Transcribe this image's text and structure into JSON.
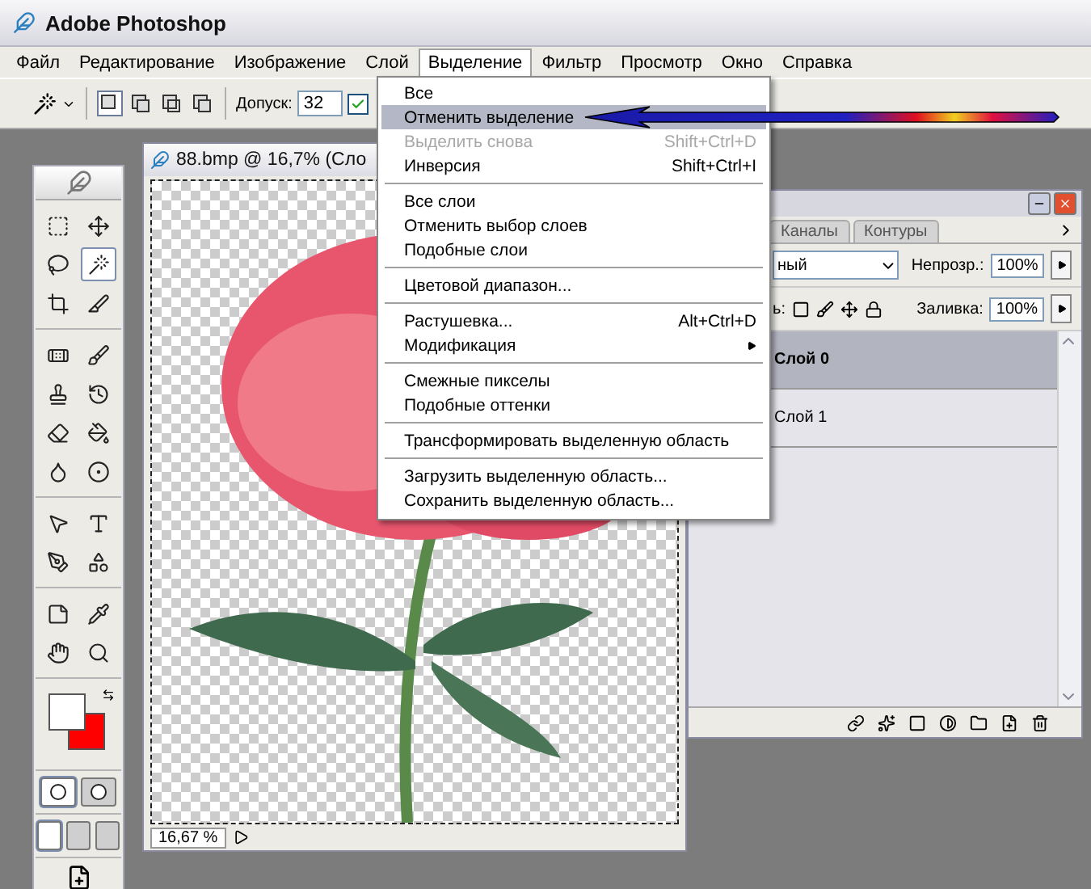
{
  "window": {
    "title": "Adobe Photoshop"
  },
  "menu_bar": [
    {
      "label": "Файл",
      "selected": false
    },
    {
      "label": "Редактирование",
      "selected": false
    },
    {
      "label": "Изображение",
      "selected": false
    },
    {
      "label": "Слой",
      "selected": false
    },
    {
      "label": "Выделение",
      "selected": true
    },
    {
      "label": "Фильтр",
      "selected": false
    },
    {
      "label": "Просмотр",
      "selected": false
    },
    {
      "label": "Окно",
      "selected": false
    },
    {
      "label": "Справка",
      "selected": false
    }
  ],
  "options_bar": {
    "selection_modes": [
      {
        "selected": true
      },
      {
        "selected": false
      },
      {
        "selected": false
      },
      {
        "selected": false
      }
    ],
    "tolerance_label": "Допуск:",
    "tolerance_value": "32",
    "checkbox": {
      "checked": true
    }
  },
  "toolbox": {
    "tool_groups": [
      [
        {
          "kind": "marquee",
          "selected": false
        },
        {
          "kind": "move",
          "selected": false
        },
        {
          "kind": "lasso",
          "selected": false
        },
        {
          "kind": "wand",
          "selected": true
        },
        {
          "kind": "crop",
          "selected": false
        },
        {
          "kind": "slice",
          "selected": false
        }
      ],
      [
        {
          "kind": "healing",
          "selected": false
        },
        {
          "kind": "brush",
          "selected": false
        },
        {
          "kind": "stamp",
          "selected": false
        },
        {
          "kind": "history",
          "selected": false
        },
        {
          "kind": "eraser",
          "selected": false
        },
        {
          "kind": "bucket",
          "selected": false
        },
        {
          "kind": "blur",
          "selected": false
        },
        {
          "kind": "dodge",
          "selected": false
        }
      ],
      [
        {
          "kind": "pointer",
          "selected": false
        },
        {
          "kind": "type",
          "selected": false
        },
        {
          "kind": "pen",
          "selected": false
        },
        {
          "kind": "shape",
          "selected": false
        }
      ],
      [
        {
          "kind": "notes",
          "selected": false
        },
        {
          "kind": "eyedropper",
          "selected": false
        },
        {
          "kind": "hand",
          "selected": false
        },
        {
          "kind": "zoom",
          "selected": false
        }
      ]
    ],
    "swatches": [
      {
        "color": "#ffffff"
      },
      {
        "color": "#ff0000"
      }
    ],
    "mask_modes": [
      {
        "selected": true
      },
      {
        "selected": false
      }
    ],
    "screen_modes": [
      {
        "selected": true
      },
      {
        "selected": false
      },
      {
        "selected": false
      }
    ]
  },
  "document": {
    "title": "88.bmp @ 16,7% (Сло",
    "zoom": "16,67 %"
  },
  "selection_menu": {
    "groups": [
      [
        {
          "label": "Все",
          "disabled": false,
          "selected": false,
          "submenu": false
        },
        {
          "label": "Отменить выделение",
          "disabled": false,
          "selected": true,
          "submenu": false
        },
        {
          "label": "Выделить снова",
          "shortcut": "Shift+Ctrl+D",
          "disabled": true,
          "selected": false,
          "submenu": false
        },
        {
          "label": "Инверсия",
          "shortcut": "Shift+Ctrl+I",
          "disabled": false,
          "selected": false,
          "submenu": false
        }
      ],
      [
        {
          "label": "Все слои",
          "disabled": false,
          "selected": false,
          "submenu": false
        },
        {
          "label": "Отменить выбор слоев",
          "disabled": false,
          "selected": false,
          "submenu": false
        },
        {
          "label": "Подобные слои",
          "disabled": false,
          "selected": false,
          "submenu": false
        }
      ],
      [
        {
          "label": "Цветовой диапазон...",
          "disabled": false,
          "selected": false,
          "submenu": false
        }
      ],
      [
        {
          "label": "Растушевка...",
          "shortcut": "Alt+Ctrl+D",
          "disabled": false,
          "selected": false,
          "submenu": false
        },
        {
          "label": "Модификация",
          "disabled": false,
          "selected": false,
          "submenu": true
        }
      ],
      [
        {
          "label": "Смежные пикселы",
          "disabled": false,
          "selected": false,
          "submenu": false
        },
        {
          "label": "Подобные оттенки",
          "disabled": false,
          "selected": false,
          "submenu": false
        }
      ],
      [
        {
          "label": "Трансформировать выделенную область",
          "disabled": false,
          "selected": false,
          "submenu": false
        }
      ],
      [
        {
          "label": "Загрузить выделенную область...",
          "disabled": false,
          "selected": false,
          "submenu": false
        },
        {
          "label": "Сохранить выделенную область...",
          "disabled": false,
          "selected": false,
          "submenu": false
        }
      ]
    ]
  },
  "layers_panel": {
    "tabs": [
      {
        "label": "Каналы",
        "selected": false
      },
      {
        "label": "Контуры",
        "selected": false
      }
    ],
    "blend_mode": "ный",
    "opacity_label": "Непрозр.:",
    "opacity": "100%",
    "lock_label": "ь:",
    "fill_label": "Заливка:",
    "fill": "100%",
    "layers": [
      {
        "name": "Слой 0",
        "selected": true
      },
      {
        "name": "Слой 1",
        "selected": false
      }
    ]
  }
}
